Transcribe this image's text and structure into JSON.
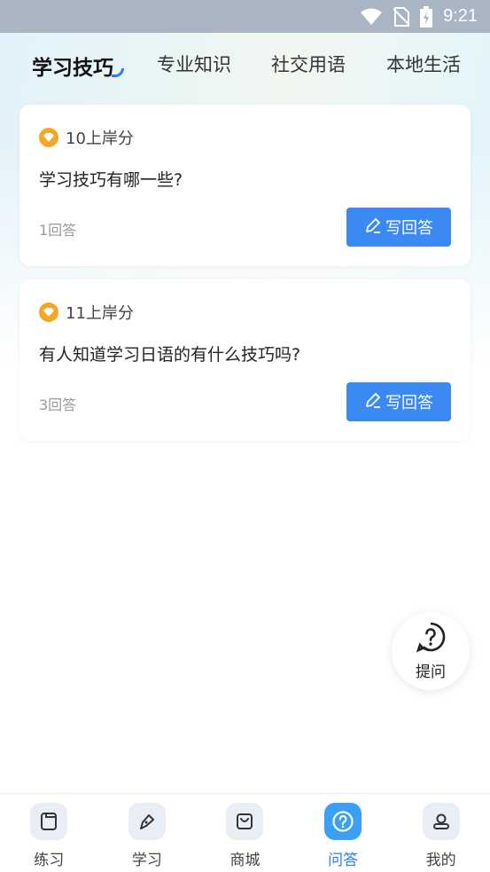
{
  "status_bar": {
    "time": "9:21",
    "icons": [
      "wifi-icon",
      "no-sim-icon",
      "battery-charging-icon"
    ]
  },
  "tabs": [
    {
      "label": "学习技巧",
      "active": true
    },
    {
      "label": "专业知识",
      "active": false
    },
    {
      "label": "社交用语",
      "active": false
    },
    {
      "label": "本地生活",
      "active": false
    }
  ],
  "questions": [
    {
      "reward": "10上岸分",
      "title": "学习技巧有哪一些?",
      "answers": "1回答",
      "button": "写回答"
    },
    {
      "reward": "11上岸分",
      "title": "有人知道学习日语的有什么技巧吗?",
      "answers": "3回答",
      "button": "写回答"
    }
  ],
  "ask_button": {
    "label": "提问",
    "icon": "question-bubble-icon"
  },
  "bottom_nav": [
    {
      "label": "练习",
      "icon": "practice-icon",
      "active": false
    },
    {
      "label": "学习",
      "icon": "pen-icon",
      "active": false
    },
    {
      "label": "商城",
      "icon": "shop-bag-icon",
      "active": false
    },
    {
      "label": "问答",
      "icon": "question-icon",
      "active": true
    },
    {
      "label": "我的",
      "icon": "profile-icon",
      "active": false
    }
  ],
  "colors": {
    "accent": "#3b8af4",
    "coin": "#f5a623",
    "status_bar": "#a9b5c2"
  }
}
